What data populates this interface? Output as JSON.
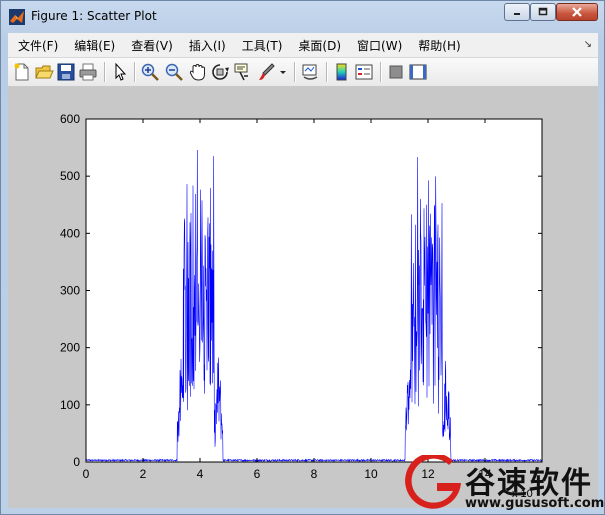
{
  "window": {
    "title": "Figure 1: Scatter Plot",
    "app_icon": "matlab-icon"
  },
  "menu": {
    "items": [
      "文件(F)",
      "编辑(E)",
      "查看(V)",
      "插入(I)",
      "工具(T)",
      "桌面(D)",
      "窗口(W)",
      "帮助(H)"
    ],
    "dock_glyph": "↘"
  },
  "toolbar": {
    "tools": [
      "new-figure-icon",
      "open-file-icon",
      "save-icon",
      "print-icon",
      "edit-plot-arrow-icon",
      "zoom-in-icon",
      "zoom-out-icon",
      "pan-hand-icon",
      "rotate-3d-icon",
      "data-cursor-icon",
      "brush-icon",
      "brush-dropdown-icon",
      "link-plot-icon",
      "insert-colorbar-icon",
      "insert-legend-icon",
      "hide-plot-tools-icon",
      "show-plot-tools-icon"
    ]
  },
  "watermark": {
    "name": "谷速软件",
    "url": "www.gususoft.com"
  },
  "chart_data": {
    "type": "line",
    "title": "",
    "xlabel": "",
    "ylabel": "",
    "x_exponent_label": "x 10",
    "xlim": [
      0,
      16
    ],
    "ylim": [
      0,
      600
    ],
    "xticks": [
      0,
      2,
      4,
      6,
      8,
      10,
      12,
      14
    ],
    "yticks": [
      0,
      100,
      200,
      300,
      400,
      500,
      600
    ],
    "grid": false,
    "line_color": "#0000ff",
    "series": [
      {
        "description_of_shape": "spectrum",
        "baseline": 3,
        "bursts": [
          {
            "center": 4.0,
            "halfwidth": 0.65,
            "peak": 583,
            "core_low": 3.4,
            "core_high": 4.5
          },
          {
            "center": 12.0,
            "halfwidth": 0.65,
            "peak": 583,
            "core_low": 11.4,
            "core_high": 12.5
          }
        ]
      }
    ]
  }
}
